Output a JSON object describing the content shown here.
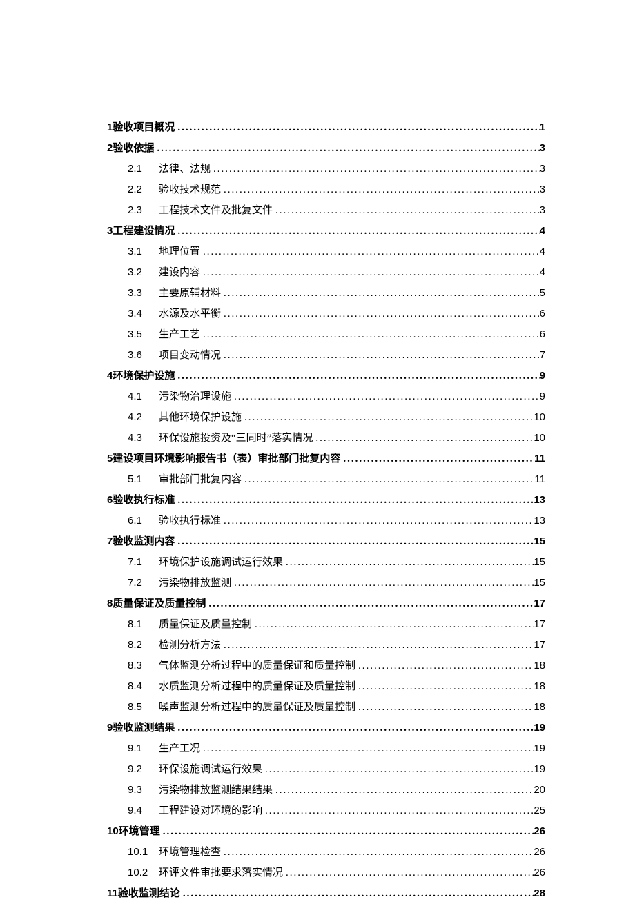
{
  "toc": [
    {
      "level": 1,
      "num": "1",
      "title": "验收项目概况",
      "page": "1"
    },
    {
      "level": 1,
      "num": "2",
      "title": "验收依据",
      "page": "3"
    },
    {
      "level": 2,
      "num": "2.1",
      "title": "法律、法规",
      "page": "3"
    },
    {
      "level": 2,
      "num": "2.2",
      "title": "验收技术规范",
      "page": "3"
    },
    {
      "level": 2,
      "num": "2.3",
      "title": "工程技术文件及批复文件",
      "page": "3"
    },
    {
      "level": 1,
      "num": "3",
      "title": "工程建设情况",
      "page": "4"
    },
    {
      "level": 2,
      "num": "3.1",
      "title": "地理位置",
      "page": "4"
    },
    {
      "level": 2,
      "num": "3.2",
      "title": "建设内容",
      "page": "4"
    },
    {
      "level": 2,
      "num": "3.3",
      "title": "主要原辅材料",
      "page": "5"
    },
    {
      "level": 2,
      "num": "3.4",
      "title": "水源及水平衡",
      "page": "6"
    },
    {
      "level": 2,
      "num": "3.5",
      "title": "生产工艺",
      "page": "6"
    },
    {
      "level": 2,
      "num": "3.6",
      "title": "项目变动情况",
      "page": "7"
    },
    {
      "level": 1,
      "num": "4",
      "title": "环境保护设施",
      "page": "9"
    },
    {
      "level": 2,
      "num": "4.1",
      "title": "污染物治理设施",
      "page": "9"
    },
    {
      "level": 2,
      "num": "4.2",
      "title": "其他环境保护设施",
      "page": "10"
    },
    {
      "level": 2,
      "num": "4.3",
      "title": "环保设施投资及“三同时”落实情况",
      "page": "10"
    },
    {
      "level": 1,
      "num": "5",
      "title": "建设项目环境影响报告书（表）审批部门批复内容",
      "page": "11"
    },
    {
      "level": 2,
      "num": "5.1",
      "title": "审批部门批复内容",
      "page": "11"
    },
    {
      "level": 1,
      "num": "6",
      "title": "验收执行标准",
      "page": "13"
    },
    {
      "level": 2,
      "num": "6.1",
      "title": "验收执行标准",
      "page": "13"
    },
    {
      "level": 1,
      "num": "7",
      "title": "验收监测内容",
      "page": "15"
    },
    {
      "level": 2,
      "num": "7.1",
      "title": "环境保护设施调试运行效果",
      "page": "15"
    },
    {
      "level": 2,
      "num": "7.2",
      "title": "污染物排放监测",
      "page": "15"
    },
    {
      "level": 1,
      "num": "8",
      "title": "质量保证及质量控制",
      "page": "17"
    },
    {
      "level": 2,
      "num": "8.1",
      "title": "质量保证及质量控制",
      "page": "17"
    },
    {
      "level": 2,
      "num": "8.2",
      "title": "检测分析方法",
      "page": "17"
    },
    {
      "level": 2,
      "num": "8.3",
      "title": "气体监测分析过程中的质量保证和质量控制",
      "page": "18"
    },
    {
      "level": 2,
      "num": "8.4",
      "title": "水质监测分析过程中的质量保证及质量控制",
      "page": "18"
    },
    {
      "level": 2,
      "num": "8.5",
      "title": "噪声监测分析过程中的质量保证及质量控制",
      "page": "18"
    },
    {
      "level": 1,
      "num": "9",
      "title": "验收监测结果",
      "page": "19"
    },
    {
      "level": 2,
      "num": "9.1",
      "title": "生产工况",
      "page": "19"
    },
    {
      "level": 2,
      "num": "9.2",
      "title": "环保设施调试运行效果",
      "page": "19"
    },
    {
      "level": 2,
      "num": "9.3",
      "title": "污染物排放监测结果结果",
      "page": "20"
    },
    {
      "level": 2,
      "num": "9.4",
      "title": "工程建设对环境的影响",
      "page": "25"
    },
    {
      "level": 1,
      "num": "10",
      "title": "环境管理",
      "page": "26"
    },
    {
      "level": 2,
      "num": "10.1",
      "title": "环境管理检查",
      "page": "26"
    },
    {
      "level": 2,
      "num": "10.2",
      "title": "环评文件审批要求落实情况",
      "page": "26"
    },
    {
      "level": 1,
      "num": "11",
      "title": "验收监测结论",
      "page": "28"
    }
  ]
}
